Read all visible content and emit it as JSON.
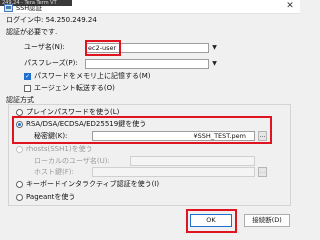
{
  "window": {
    "background_title": "249.24 - Tera Term VT",
    "title": "SSH認証",
    "close_glyph": "✕"
  },
  "header": {
    "login_label": "ログイン中: 54.250.249.24",
    "auth_required": "認証が必要です."
  },
  "form": {
    "username_label": "ユーザ名(N):",
    "username_value": "ec2-user",
    "passphrase_label": "パスフレーズ(P):",
    "passphrase_value": "",
    "remember_password": "パスワードをメモリ上に記憶する(M)",
    "remember_password_checked": true,
    "agent_forward": "エージェント転送する(O)",
    "agent_forward_checked": false
  },
  "auth_method": {
    "group_label": "認証方式",
    "plain_password": "プレインパスワードを使う(L)",
    "rsa_label": "RSA/DSA/ECDSA/ED25519鍵を使う",
    "private_key_label": "秘密鍵(K):",
    "private_key_value": "¥SSH_TEST.pem",
    "browse_label": "...",
    "rhosts_label": "rhosts(SSH1)を使う",
    "local_user_label": "ローカルのユーザ名(U):",
    "host_key_label": "ホスト鍵(F):",
    "keyboard_interactive": "キーボードインタラクティブ認証を使う(I)",
    "pageant": "Pageantを使う",
    "selected": "rsa"
  },
  "buttons": {
    "ok": "OK",
    "disconnect": "接続断(D)"
  },
  "colors": {
    "highlight_red": "#e0141e",
    "accent_blue": "#1f6fd1"
  }
}
